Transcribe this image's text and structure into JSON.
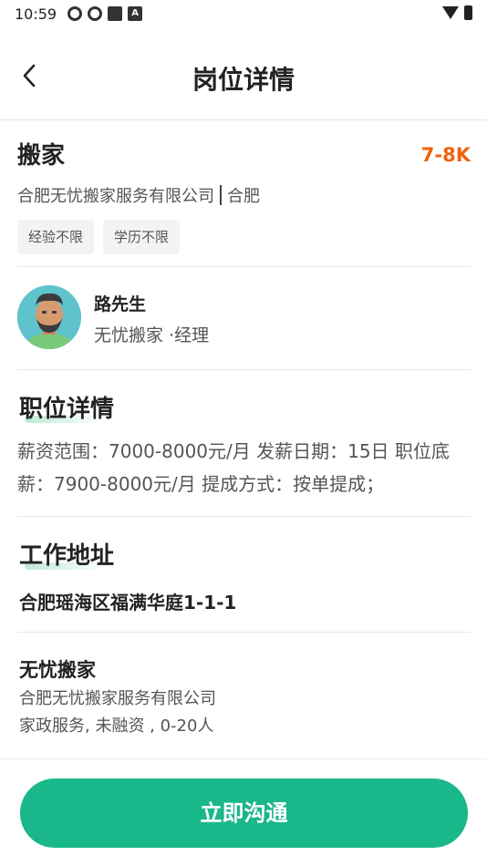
{
  "status_bar": {
    "time": "10:59",
    "badge_letter": "A"
  },
  "header": {
    "title": "岗位详情"
  },
  "job": {
    "title": "搬家",
    "salary": "7-8K",
    "company": "合肥无忧搬家服务有限公司",
    "city": "合肥",
    "tags": [
      "经验不限",
      "学历不限"
    ]
  },
  "recruiter": {
    "name": "路先生",
    "role": "无忧搬家 ·经理"
  },
  "position_details": {
    "title": "职位详情",
    "text": "薪资范围：7000-8000元/月 发薪日期：15日 职位底薪：7900-8000元/月 提成方式：按单提成；"
  },
  "work_address": {
    "title": "工作地址",
    "address": "合肥瑶海区福满华庭1-1-1"
  },
  "company": {
    "short_name": "无忧搬家",
    "full_name": "合肥无忧搬家服务有限公司",
    "info": "家政服务, 未融资 , 0-20人"
  },
  "cta": {
    "label": "立即沟通"
  },
  "colors": {
    "accent": "#1ab78a",
    "salary": "#f0620c"
  }
}
